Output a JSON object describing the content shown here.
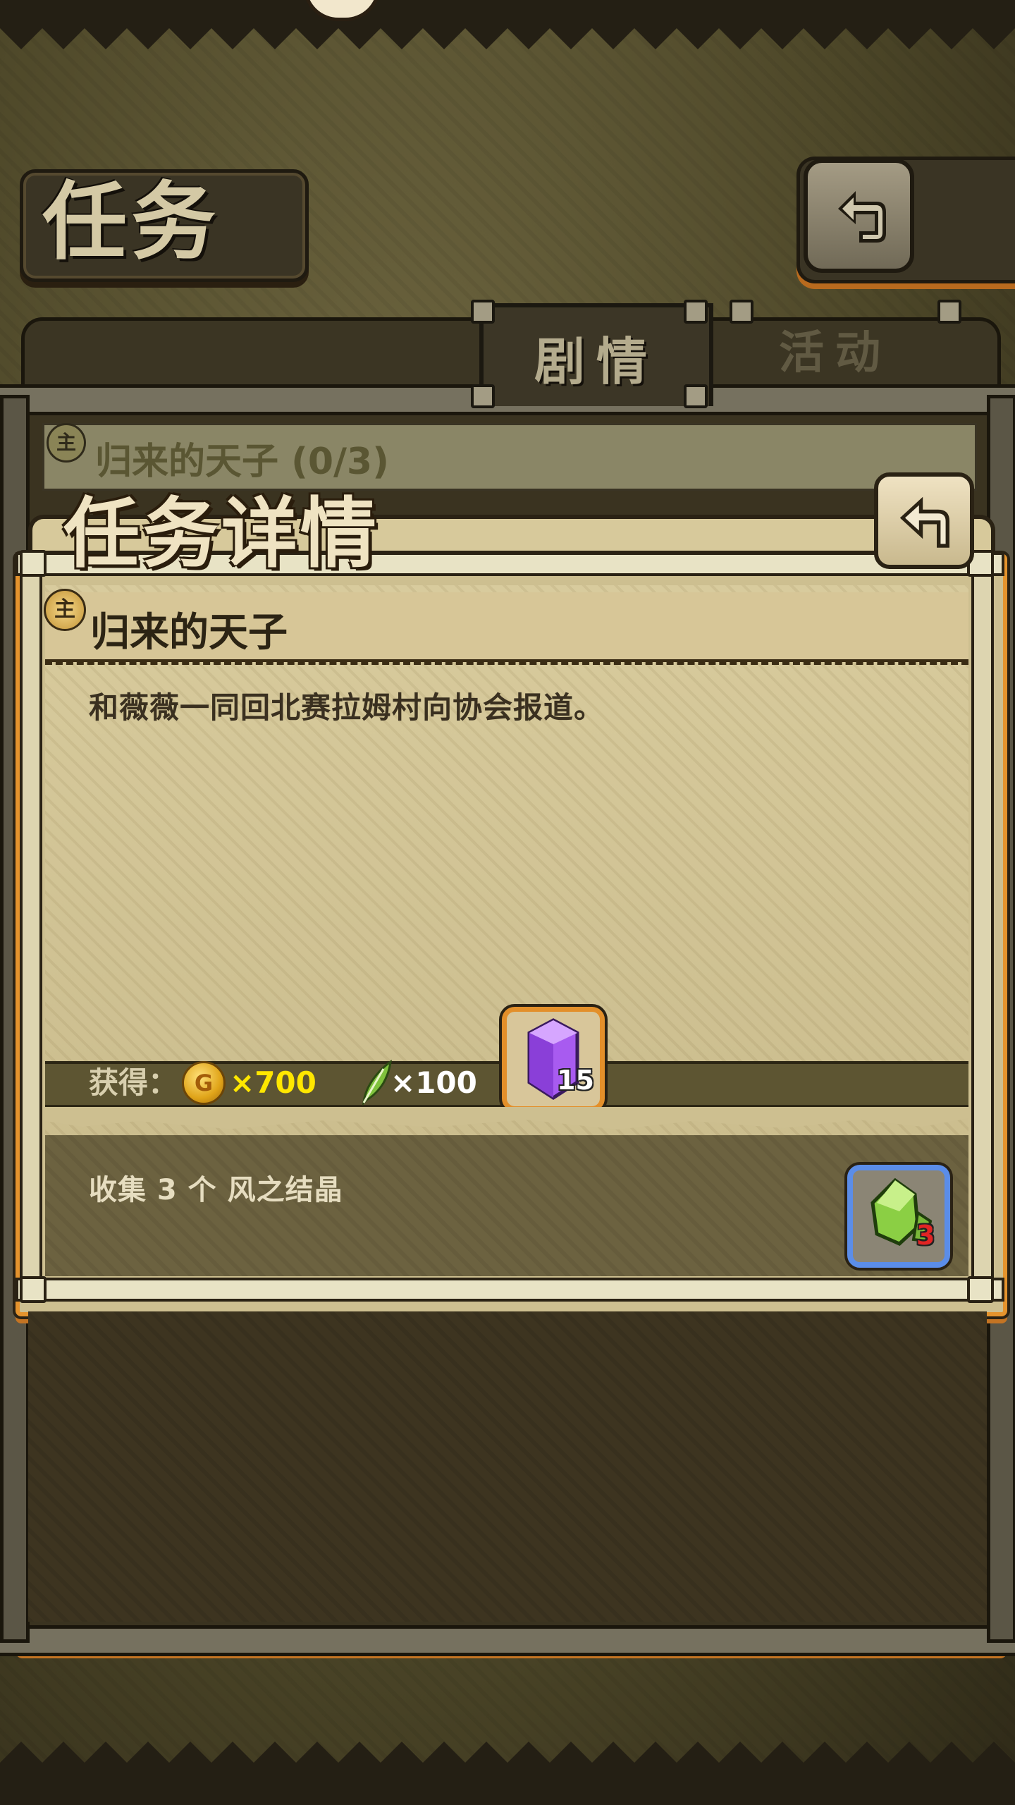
{
  "header": {
    "title": "任务"
  },
  "tabs": [
    {
      "label": "剧情",
      "active": true
    },
    {
      "label": "活动",
      "active": false
    }
  ],
  "quest_list": [
    {
      "badge": "主",
      "name": "归来的天子 (0/3)"
    }
  ],
  "detail": {
    "title": "任务详情",
    "quest_badge": "主",
    "quest_name": "归来的天子",
    "description": "和薇薇一同回北赛拉姆村向协会报道。",
    "rewards": {
      "label": "获得：",
      "gold_icon_letter": "G",
      "gold_amount": "×700",
      "feather_amount": "×100",
      "crystal_count": "15"
    },
    "objective": {
      "text": "收集 3 个 风之结晶",
      "item_count": "3"
    }
  },
  "colors": {
    "accent_orange": "#e38f2a",
    "gold_text": "#ffe700",
    "wind_slot_border": "#5b8de8",
    "count_red": "#e12424"
  },
  "icons": [
    "compass-icon",
    "back-arrow-icon",
    "main-quest-badge-icon",
    "gold-coin-icon",
    "feather-icon",
    "purple-crystal-icon",
    "wind-crystal-icon"
  ]
}
